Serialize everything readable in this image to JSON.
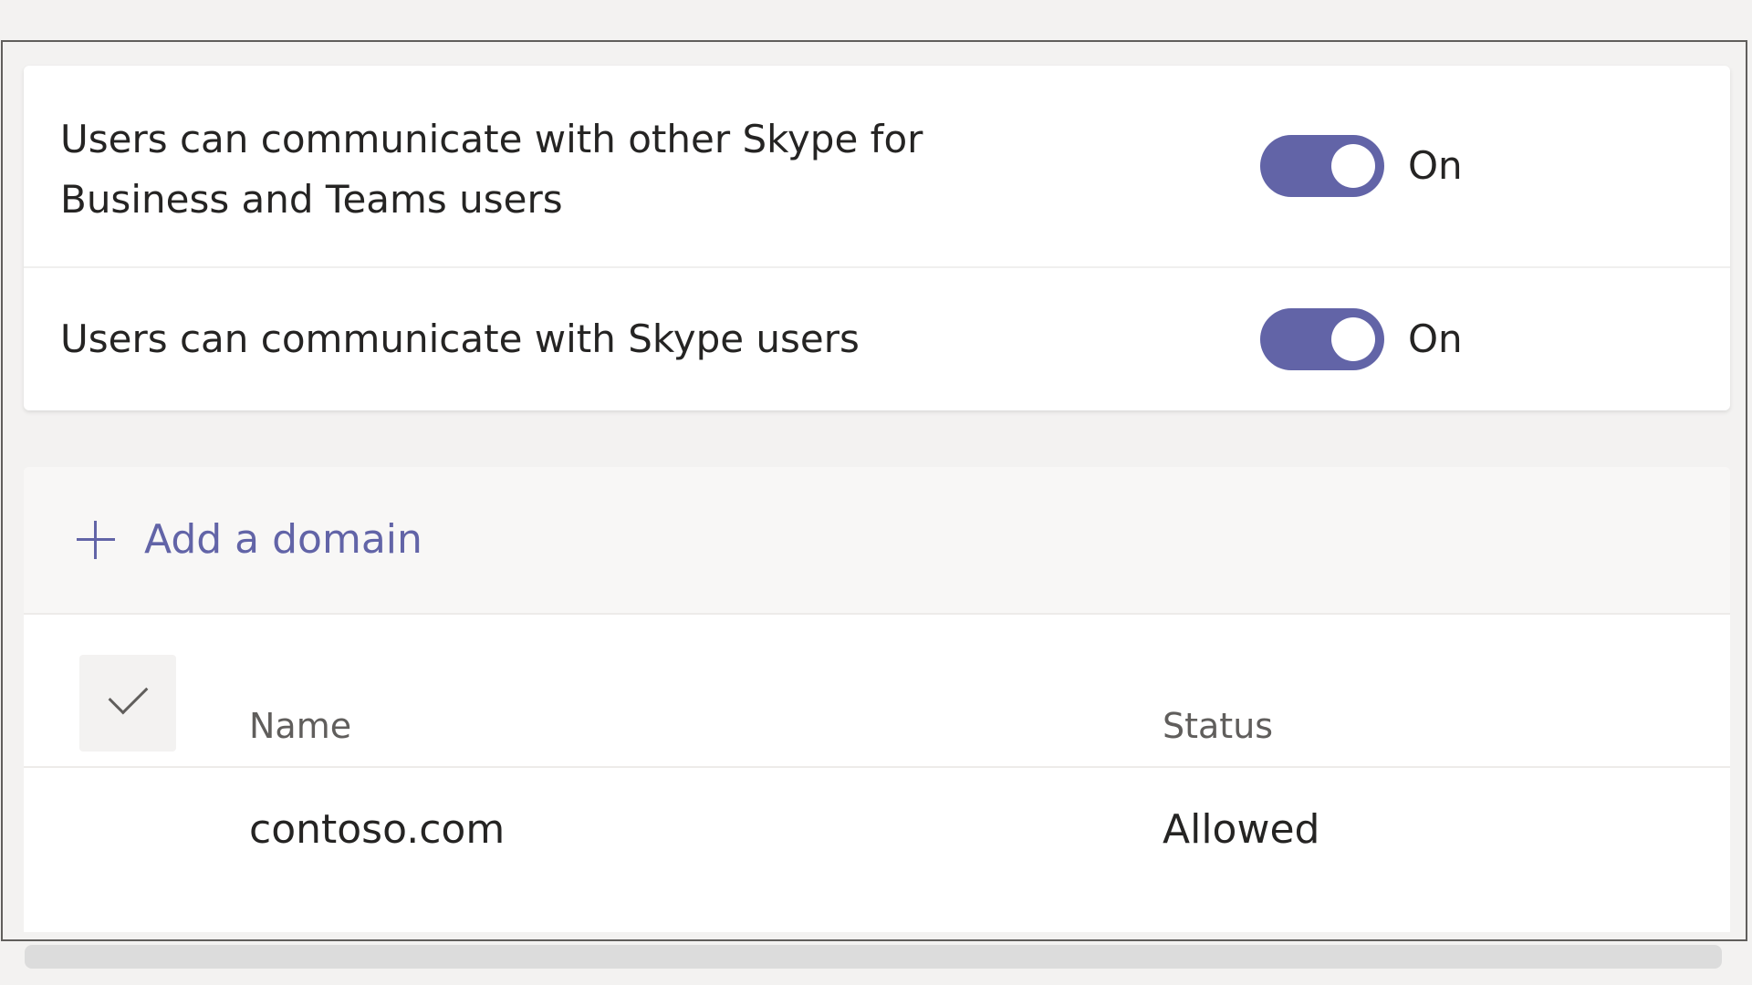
{
  "settings": [
    {
      "label": "Users can communicate with other Skype for Business and Teams users",
      "state_text": "On",
      "enabled": true
    },
    {
      "label": "Users can communicate with Skype users",
      "state_text": "On",
      "enabled": true
    }
  ],
  "domains": {
    "add_label": "Add a domain",
    "columns": {
      "name": "Name",
      "status": "Status"
    },
    "rows": [
      {
        "name": "contoso.com",
        "status": "Allowed"
      }
    ]
  },
  "colors": {
    "accent": "#6264a7",
    "background": "#f3f2f1"
  },
  "icons": {
    "add": "plus-icon",
    "select_all": "check-icon"
  }
}
